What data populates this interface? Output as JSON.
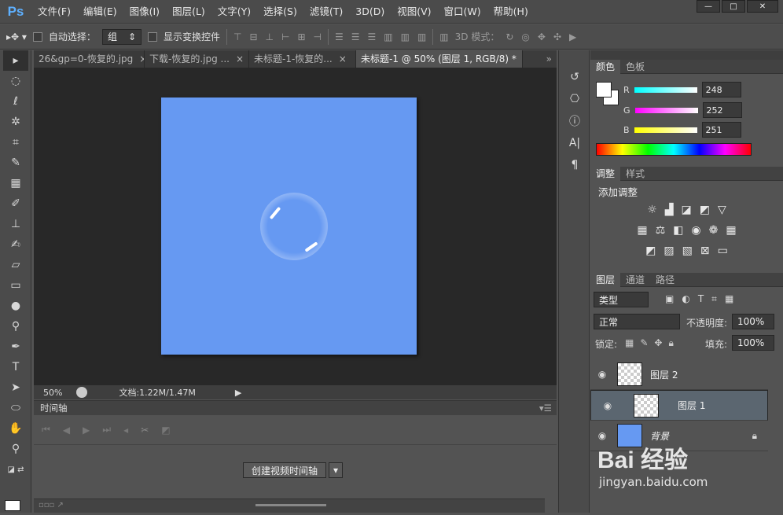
{
  "app": {
    "logo": "Ps"
  },
  "menu": [
    "文件(F)",
    "编辑(E)",
    "图像(I)",
    "图层(L)",
    "文字(Y)",
    "选择(S)",
    "滤镜(T)",
    "3D(D)",
    "视图(V)",
    "窗口(W)",
    "帮助(H)"
  ],
  "window_controls": {
    "minimize": "—",
    "maximize": "□",
    "close": "✕"
  },
  "options": {
    "auto_select_label": "自动选择：",
    "auto_select_value": "组",
    "show_transform_label": "显示变换控件",
    "mode_label": "3D 模式："
  },
  "tabs": [
    {
      "label": "26&gp=0-恢复的.jpg",
      "close": "×"
    },
    {
      "label": "下载-恢复的.jpg ...",
      "close": "×"
    },
    {
      "label": "未标题-1-恢复的...",
      "close": "×"
    },
    {
      "label": "未标题-1 @ 50% (图层 1, RGB/8) *",
      "close": "×"
    }
  ],
  "status": {
    "zoom": "50%",
    "doc": "文档:1.22M/1.47M"
  },
  "timeline": {
    "title": "时间轴",
    "create_button": "创建视频时间轴"
  },
  "color_panel": {
    "tabs": [
      "颜色",
      "色板"
    ],
    "r_label": "R",
    "r": "248",
    "g_label": "G",
    "g": "252",
    "b_label": "B",
    "b": "251"
  },
  "adjust_panel": {
    "tabs": [
      "调整",
      "样式"
    ],
    "title": "添加调整"
  },
  "layers_panel": {
    "tabs": [
      "图层",
      "通道",
      "路径"
    ],
    "filter": "类型",
    "blend": "正常",
    "opacity_label": "不透明度:",
    "opacity": "100%",
    "lock_label": "锁定:",
    "fill_label": "填充:",
    "fill": "100%",
    "layers": [
      {
        "name": "图层 2"
      },
      {
        "name": "图层 1"
      },
      {
        "name": "背景"
      }
    ]
  },
  "watermark": {
    "text": "Bai 经验",
    "url": "jingyan.baidu.com"
  },
  "colors": {
    "canvas": "#6699f2",
    "accent": "#5eb0ff"
  }
}
